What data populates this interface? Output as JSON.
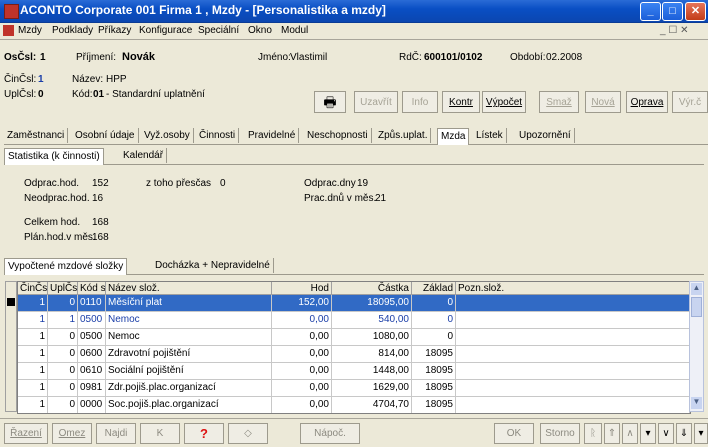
{
  "window": {
    "title": "ACONTO Corporate 001 Firma 1 , Mzdy - [Personalistika a mzdy]",
    "min": "_",
    "max": "□",
    "close": "✕",
    "restore": "_ ☐ ✕"
  },
  "menu": [
    "Mzdy",
    "Podklady",
    "Příkazy",
    "Konfigurace",
    "Speciální",
    "Okno",
    "Modul"
  ],
  "header": {
    "oscsl_label": "OsČsl:",
    "oscsl_value": "1",
    "prijmeni_label": "Příjmení:",
    "prijmeni_value": "Novák",
    "jmeno_label": "Jméno:",
    "jmeno_value": "Vlastimil",
    "rc_label": "RdČ:",
    "rc_value": "600101/0102",
    "obdobi_label": "Období:",
    "obdobi_value": "02.2008",
    "cincsl_label": "ČinČsl:",
    "cincsl_value": "1",
    "nazev_label": "Název:",
    "nazev_value": "HPP",
    "uplcsl_label": "UplČsl:",
    "uplcsl_value": "0",
    "kod_label": "Kód:",
    "kod_value": "01",
    "kod_desc": "- Standardní uplatnění"
  },
  "toolbar": {
    "print": "🖶",
    "uzavrit": "Uzavřít",
    "info": "Info",
    "kontr": "Kontr",
    "vypocet": "Výpočet",
    "smaz": "Smaž",
    "nova": "Nová",
    "oprava": "Oprava",
    "vyr": "Výr.č"
  },
  "main_tabs": [
    "Zaměstnanci",
    "Osobní údaje",
    "Vyž.osoby",
    "Činnosti",
    "Pravidelné",
    "Neschopnosti",
    "Způs.uplat.",
    "Mzda",
    "Lístek",
    "Upozornění"
  ],
  "sub_tabs": [
    "Statistika (k činnosti)",
    "Kalendář"
  ],
  "stats": {
    "odprac_hod_label": "Odprac.hod.",
    "odprac_hod_value": "152",
    "z_toho_prescas_label": "z toho přesčas",
    "z_toho_prescas_value": "0",
    "odprac_dny_label": "Odprac.dny",
    "odprac_dny_value": "19",
    "neodprac_hod_label": "Neodprac.hod.",
    "neodprac_hod_value": "16",
    "prac_dnu_label": "Prac.dnů v měs.",
    "prac_dnu_value": "21",
    "celkem_hod_label": "Celkem hod.",
    "celkem_hod_value": "168",
    "plan_hod_label": "Plán.hod.v měs.",
    "plan_hod_value": "168"
  },
  "lower_tabs": [
    "Vypočtené mzdové složky",
    "Docházka + Nepravidelné"
  ],
  "grid": {
    "columns": [
      "ČinČsl",
      "UplČsl",
      "Kód slo",
      "Název slož.",
      "Hod",
      "Částka",
      "Základ",
      "Pozn.slož."
    ],
    "rows": [
      [
        "1",
        "0",
        "0110",
        "Měsíční plat",
        "152,00",
        "18095,00",
        "0",
        ""
      ],
      [
        "1",
        "1",
        "0500",
        "Nemoc",
        "0,00",
        "540,00",
        "0",
        ""
      ],
      [
        "1",
        "0",
        "0500",
        "Nemoc",
        "0,00",
        "1080,00",
        "0",
        ""
      ],
      [
        "1",
        "0",
        "0600",
        "Zdravotní pojištění",
        "0,00",
        "814,00",
        "18095",
        ""
      ],
      [
        "1",
        "0",
        "0610",
        "Sociální pojištění",
        "0,00",
        "1448,00",
        "18095",
        ""
      ],
      [
        "1",
        "0",
        "0981",
        "Zdr.pojiš.plac.organizací",
        "0,00",
        "1629,00",
        "18095",
        ""
      ],
      [
        "1",
        "0",
        "0000",
        "Soc.pojiš.plac.organizací",
        "0,00",
        "4704,70",
        "18095",
        ""
      ]
    ]
  },
  "bottom": {
    "razeni": "Řazení",
    "omez": "Omez",
    "najdi": "Najdi",
    "k": "K",
    "help": "?",
    "napoc": "Nápoč.",
    "ok": "OK",
    "storno": "Storno"
  },
  "colors": {
    "titlebar": "#0a4fc4",
    "selection": "#316ac5",
    "window_bg": "#ece9d8"
  }
}
